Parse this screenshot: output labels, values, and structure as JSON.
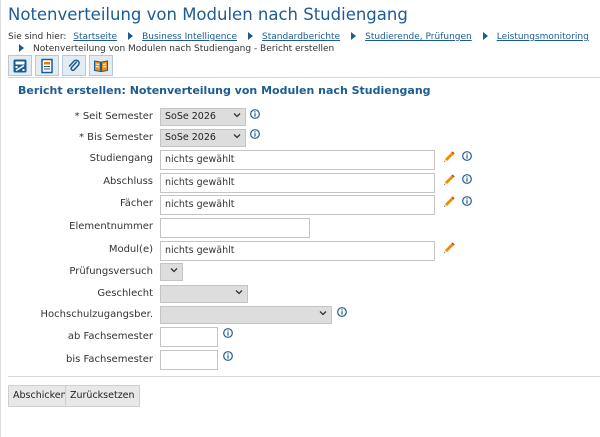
{
  "page": {
    "title": "Notenverteilung von Modulen nach Studiengang"
  },
  "breadcrumb": {
    "prefix": "Sie sind hier:",
    "items": [
      "Startseite",
      "Business Intelligence",
      "Standardberichte",
      "Studierende, Prüfungen",
      "Leistungsmonitoring"
    ],
    "current": "Notenverteilung von Modulen nach Studiengang - Bericht erstellen"
  },
  "toolbar": {
    "icons": [
      "calculator-icon",
      "document-icon",
      "paperclip-icon",
      "book-icon"
    ]
  },
  "form": {
    "title": "Bericht erstellen: Notenverteilung von Modulen nach Studiengang",
    "seit_semester": {
      "label": "* Seit Semester",
      "value": "SoSe 2026"
    },
    "bis_semester": {
      "label": "* Bis Semester",
      "value": "SoSe 2026"
    },
    "studiengang": {
      "label": "Studiengang",
      "value": "nichts gewählt"
    },
    "abschluss": {
      "label": "Abschluss",
      "value": "nichts gewählt"
    },
    "faecher": {
      "label": "Fächer",
      "value": "nichts gewählt"
    },
    "elementnummer": {
      "label": "Elementnummer",
      "value": ""
    },
    "module": {
      "label": "Modul(e)",
      "value": "nichts gewählt"
    },
    "pruefungsversuch": {
      "label": "Prüfungsversuch",
      "value": ""
    },
    "geschlecht": {
      "label": "Geschlecht",
      "value": ""
    },
    "hzb": {
      "label": "Hochschulzugangsber.",
      "value": ""
    },
    "ab_fachsemester": {
      "label": "ab Fachsemester",
      "value": ""
    },
    "bis_fachsemester": {
      "label": "bis Fachsemester",
      "value": ""
    }
  },
  "buttons": {
    "submit": "Abschicken",
    "reset": "Zurücksetzen"
  },
  "colors": {
    "accent": "#1d5c93",
    "pencil": "#e87b00"
  }
}
